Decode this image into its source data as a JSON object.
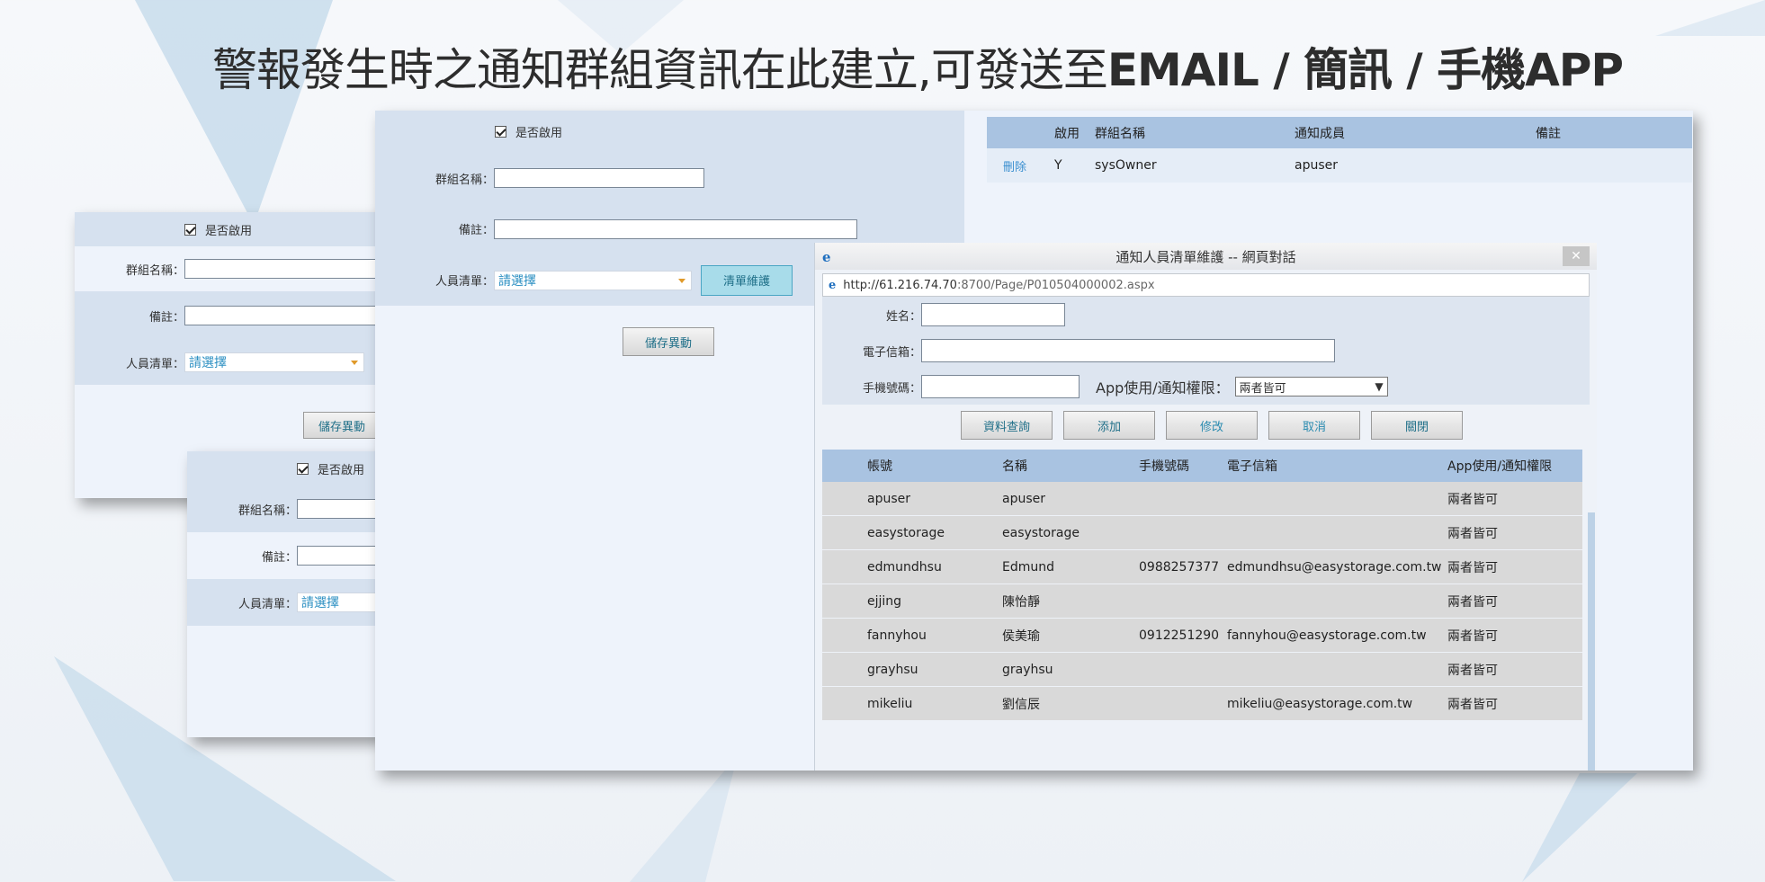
{
  "headline": {
    "lead": "警報發生時之通知群組資訊在此建立,可發送至",
    "channels": "EMAIL / 簡訊 / 手機APP"
  },
  "form": {
    "enable_label": "是否啟用",
    "group_name_label": "群組名稱：",
    "remark_label": "備註：",
    "member_list_label": "人員清單：",
    "member_list_value": "請選擇",
    "maintain_button": "清單維護",
    "save_button": "儲存異動",
    "save_button_short": "儲存異動"
  },
  "group_table": {
    "headers": [
      "啟用",
      "群組名稱",
      "通知成員",
      "備註"
    ],
    "rows": [
      {
        "action": "刪除",
        "enabled": "Y",
        "name": "sysOwner",
        "members": "apuser",
        "remark": ""
      }
    ]
  },
  "dialog": {
    "title": "通知人員清單維護 -- 網頁對話",
    "url_host": "http://61.216.74.70",
    "url_path": ":8700/Page/P010504000002.aspx",
    "name_label": "姓名：",
    "email_label": "電子信箱：",
    "phone_label": "手機號碼：",
    "app_label": "App使用/通知權限：",
    "app_value": "兩者皆可",
    "buttons": [
      "資料查詢",
      "添加",
      "修改",
      "取消",
      "關閉"
    ],
    "table_headers": [
      "帳號",
      "名稱",
      "手機號碼",
      "電子信箱",
      "App使用/通知權限"
    ],
    "rows": [
      {
        "account": "apuser",
        "name": "apuser",
        "phone": "",
        "email": "",
        "perm": "兩者皆可"
      },
      {
        "account": "easystorage",
        "name": "easystorage",
        "phone": "",
        "email": "",
        "perm": "兩者皆可"
      },
      {
        "account": "edmundhsu",
        "name": "Edmund",
        "phone": "0988257377",
        "email": "edmundhsu@easystorage.com.tw",
        "perm": "兩者皆可"
      },
      {
        "account": "ejjing",
        "name": "陳怡靜",
        "phone": "",
        "email": "",
        "perm": "兩者皆可"
      },
      {
        "account": "fannyhou",
        "name": "侯美瑜",
        "phone": "0912251290",
        "email": "fannyhou@easystorage.com.tw",
        "perm": "兩者皆可"
      },
      {
        "account": "grayhsu",
        "name": "grayhsu",
        "phone": "",
        "email": "",
        "perm": "兩者皆可"
      },
      {
        "account": "mikeliu",
        "name": "劉信辰",
        "phone": "",
        "email": "mikeliu@easystorage.com.tw",
        "perm": "兩者皆可"
      }
    ]
  }
}
